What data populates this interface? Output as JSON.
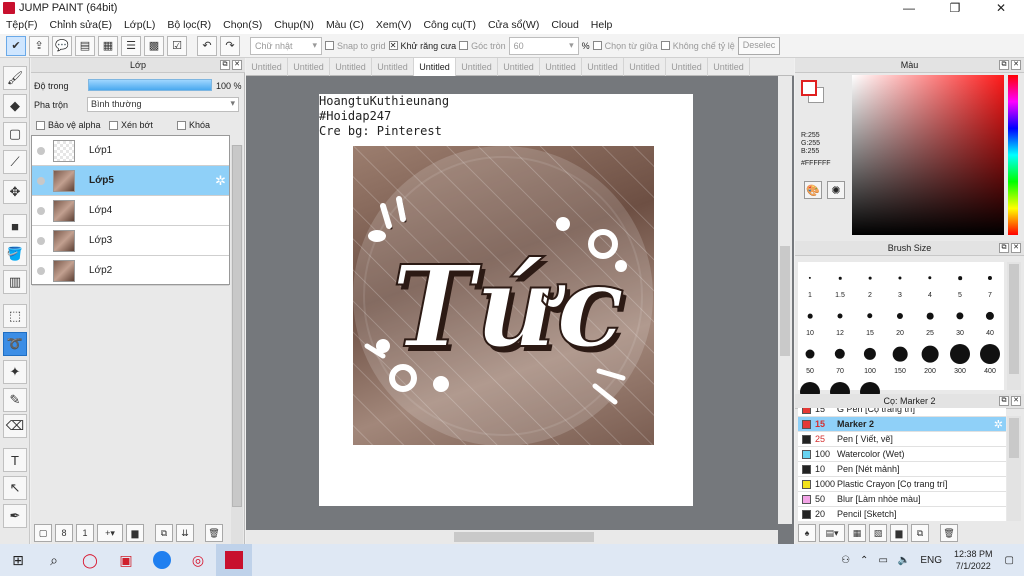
{
  "window": {
    "title": "JUMP PAINT (64bit)",
    "controls": [
      "—",
      "❐",
      "✕"
    ]
  },
  "menu": [
    "Tệp(F)",
    "Chỉnh sửa(E)",
    "Lớp(L)",
    "Bộ lọc(R)",
    "Chọn(S)",
    "Chụp(N)",
    "Màu (C)",
    "Xem(V)",
    "Công cụ(T)",
    "Cửa sổ(W)",
    "Cloud",
    "Help"
  ],
  "toolbar": {
    "shape_select": "Chữ nhật",
    "snap_label": "Snap to grid",
    "antialias_label": "Khử răng cưa",
    "round_label": "Góc tròn",
    "round_value": "60",
    "percent": "%",
    "center_label": "Chọn từ giữa",
    "ratio_label": "Không chế tỷ lệ",
    "deselect_label": "Deselec"
  },
  "layer_panel": {
    "title": "Lớp",
    "opacity_label": "Độ trong",
    "opacity_value": "100 %",
    "blend_label": "Pha trộn",
    "blend_value": "Bình thường",
    "protect_alpha": "Bảo vệ alpha",
    "clipping": "Xén bớt",
    "lock": "Khóa",
    "layers": [
      {
        "name": "Lớp1",
        "selected": false
      },
      {
        "name": "Lớp5",
        "selected": true
      },
      {
        "name": "Lớp4",
        "selected": false
      },
      {
        "name": "Lớp3",
        "selected": false
      },
      {
        "name": "Lớp2",
        "selected": false
      }
    ]
  },
  "tabs": [
    "Untitled",
    "Untitled",
    "Untitled",
    "Untitled",
    "Untitled",
    "Untitled",
    "Untitled",
    "Untitled",
    "Untitled",
    "Untitled",
    "Untitled",
    "Untitled"
  ],
  "active_tab": 4,
  "canvas": {
    "caption": [
      "HoangtuKuthieunang",
      "#Hoidap247",
      "Cre bg: Pinterest"
    ],
    "artwork_text": "Tức"
  },
  "color_panel": {
    "title": "Màu",
    "r": "R:255",
    "g": "G:255",
    "b": "B:255",
    "hex": "#FFFFFF",
    "accent": "#e02020"
  },
  "brush_panel": {
    "title": "Brush Size",
    "sizes": [
      "1",
      "1.5",
      "2",
      "3",
      "4",
      "5",
      "7",
      "10",
      "12",
      "15",
      "20",
      "25",
      "30",
      "40",
      "50",
      "70",
      "100",
      "150",
      "200",
      "300",
      "400",
      "",
      "",
      ""
    ]
  },
  "marker_panel": {
    "title": "Cọ: Marker 2",
    "items": [
      {
        "size": "15",
        "name": "G Pen [Cọ trang trí]",
        "color": "#e53935",
        "selected": false
      },
      {
        "size": "15",
        "name": "Marker 2",
        "color": "#e53935",
        "selected": true
      },
      {
        "size": "25",
        "name": "Pen [ Viết, vẽ]",
        "color": "#222222",
        "selected": false
      },
      {
        "size": "100",
        "name": "Watercolor (Wet)",
        "color": "#67d3f0",
        "selected": false
      },
      {
        "size": "10",
        "name": "Pen [Nét mảnh]",
        "color": "#222222",
        "selected": false
      },
      {
        "size": "1000",
        "name": "Plastic Crayon [Cọ trang trí]",
        "color": "#f2e21a",
        "selected": false
      },
      {
        "size": "50",
        "name": "Blur [Làm nhòe màu]",
        "color": "#f3a4e6",
        "selected": false
      },
      {
        "size": "20",
        "name": "Pencil [Sketch]",
        "color": "#222222",
        "selected": false
      }
    ]
  },
  "taskbar": {
    "lang": "ENG",
    "time": "12:38 PM",
    "date": "7/1/2022"
  }
}
